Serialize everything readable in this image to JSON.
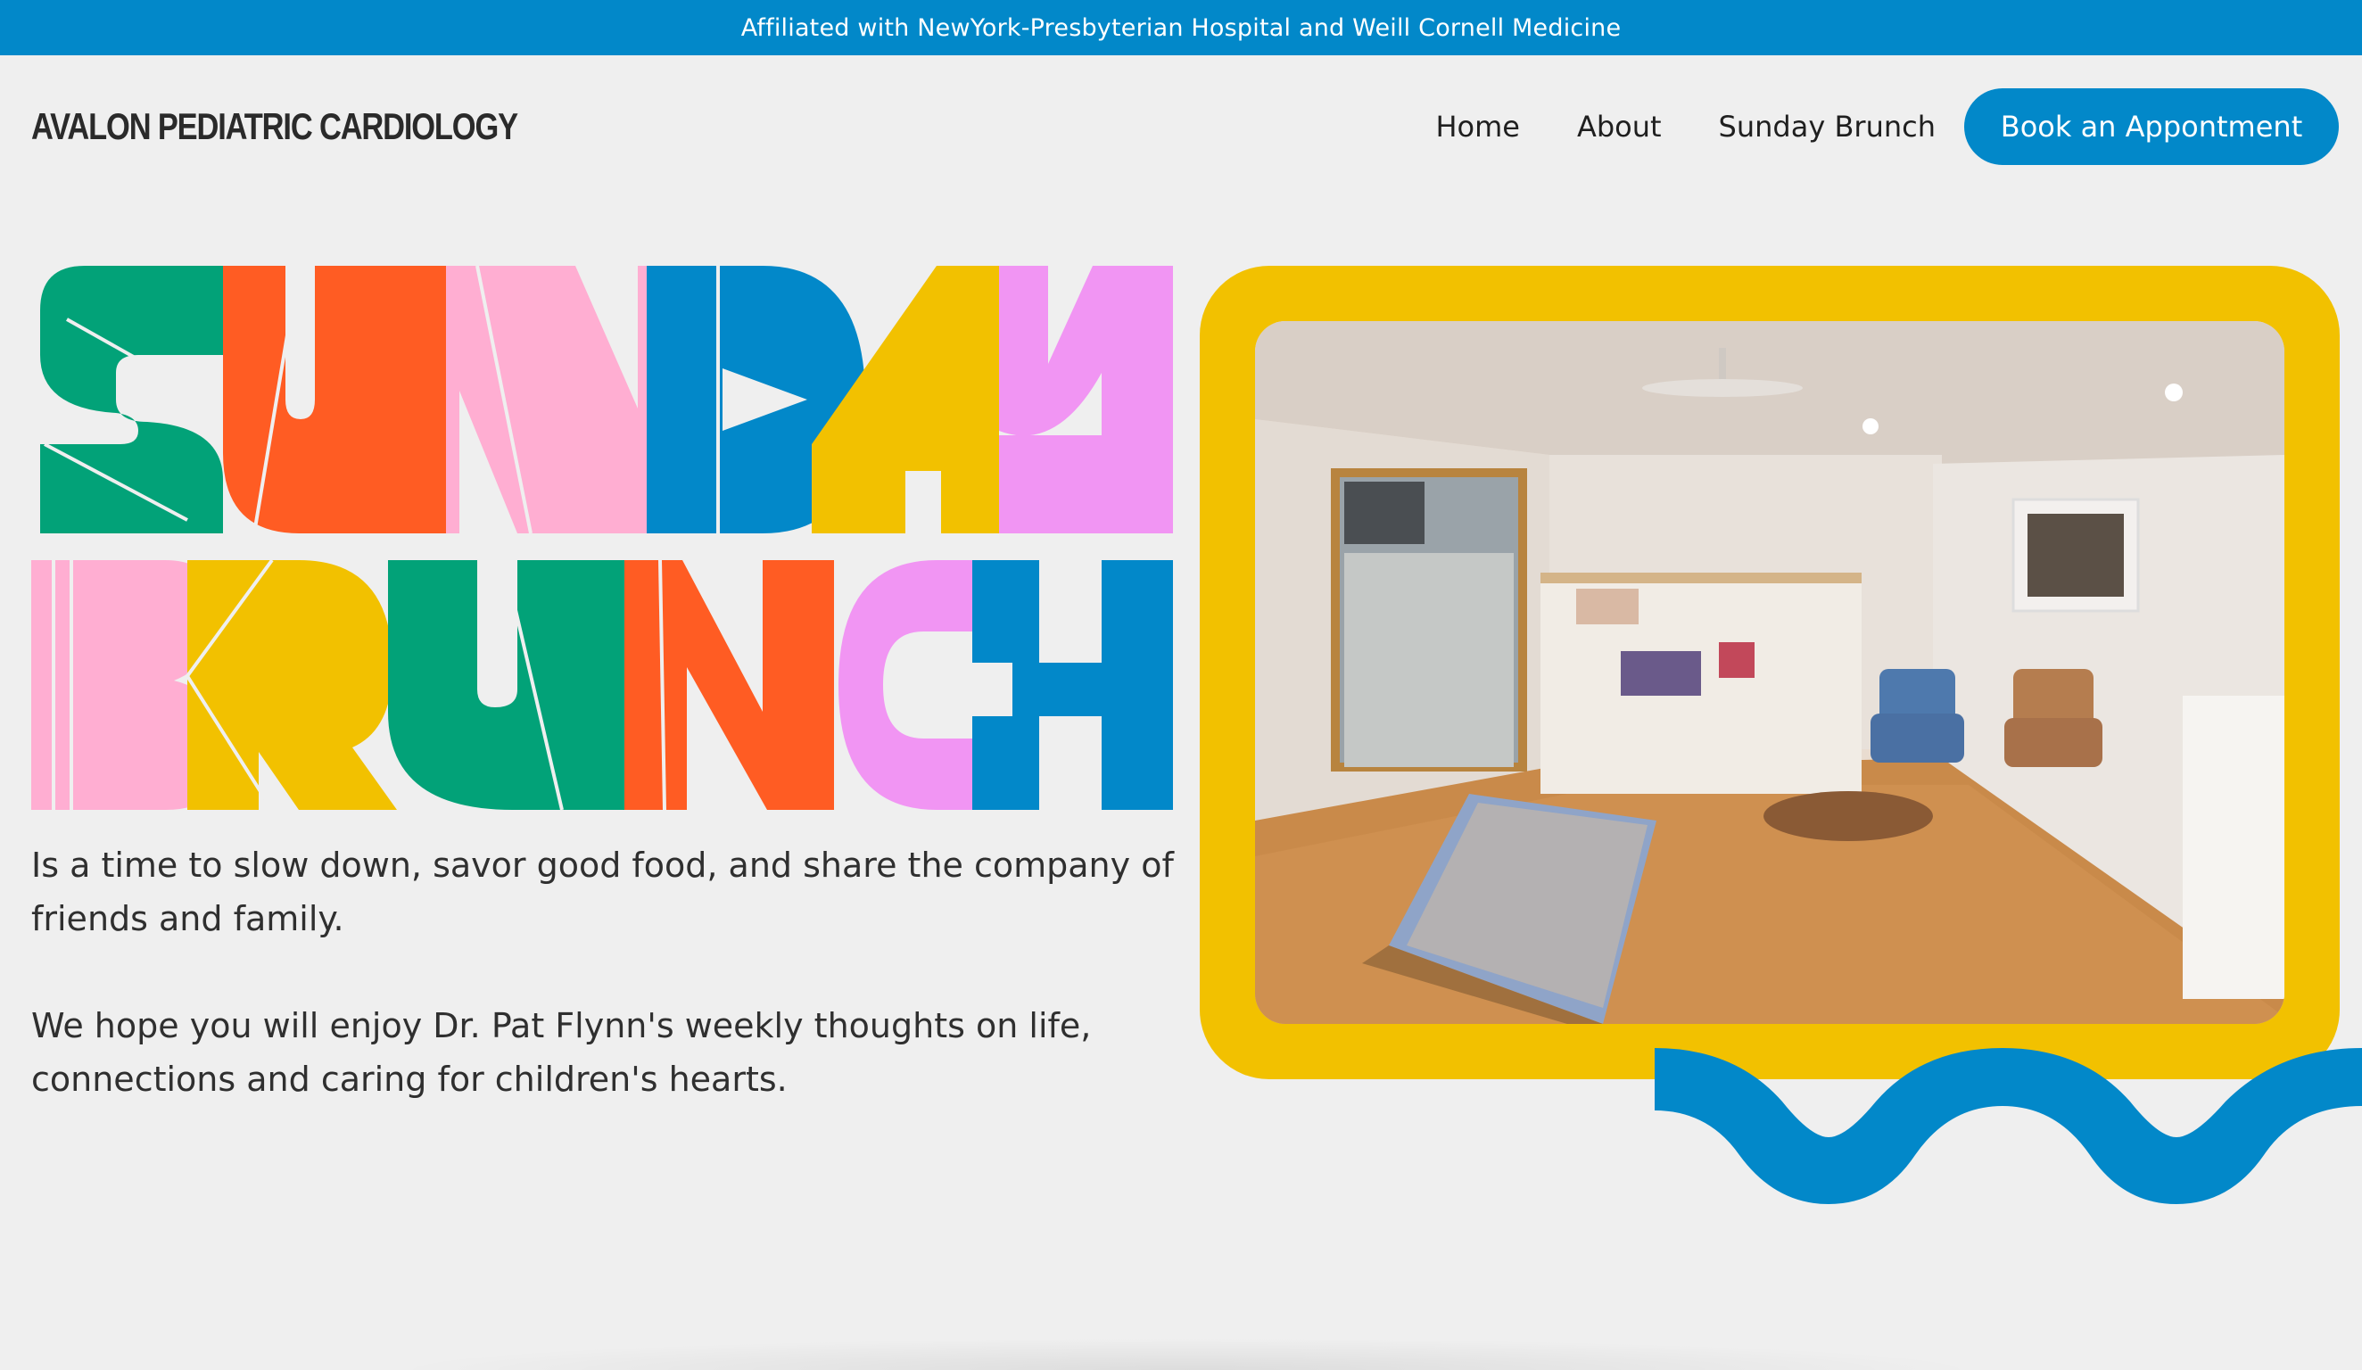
{
  "topbar": {
    "text": "Affiliated with NewYork-Presbyterian Hospital and Weill Cornell Medicine"
  },
  "header": {
    "logo": "AVALON PEDIATRIC CARDIOLOGY"
  },
  "nav": {
    "items": [
      {
        "label": "Home"
      },
      {
        "label": "About"
      },
      {
        "label": "Sunday Brunch"
      }
    ],
    "cta": "Book an Appontment"
  },
  "hero": {
    "title_line1": "SUNDAY",
    "title_line2": "BRUNCH",
    "intro_1": "Is a time to slow down, savor good food, and share the company of friends and family.",
    "intro_2": "We hope you will enjoy Dr. Pat Flynn's weekly thoughts on life, connections and caring for children's hearts."
  },
  "colors": {
    "accent_blue": "#0288c9",
    "green": "#02a278",
    "orange": "#ff5c23",
    "pink": "#ffaed2",
    "yellow": "#f2c100",
    "violet": "#f195f3",
    "background": "#efefef"
  },
  "icons": [
    "waiting-room-photo",
    "wave-decoration"
  ]
}
